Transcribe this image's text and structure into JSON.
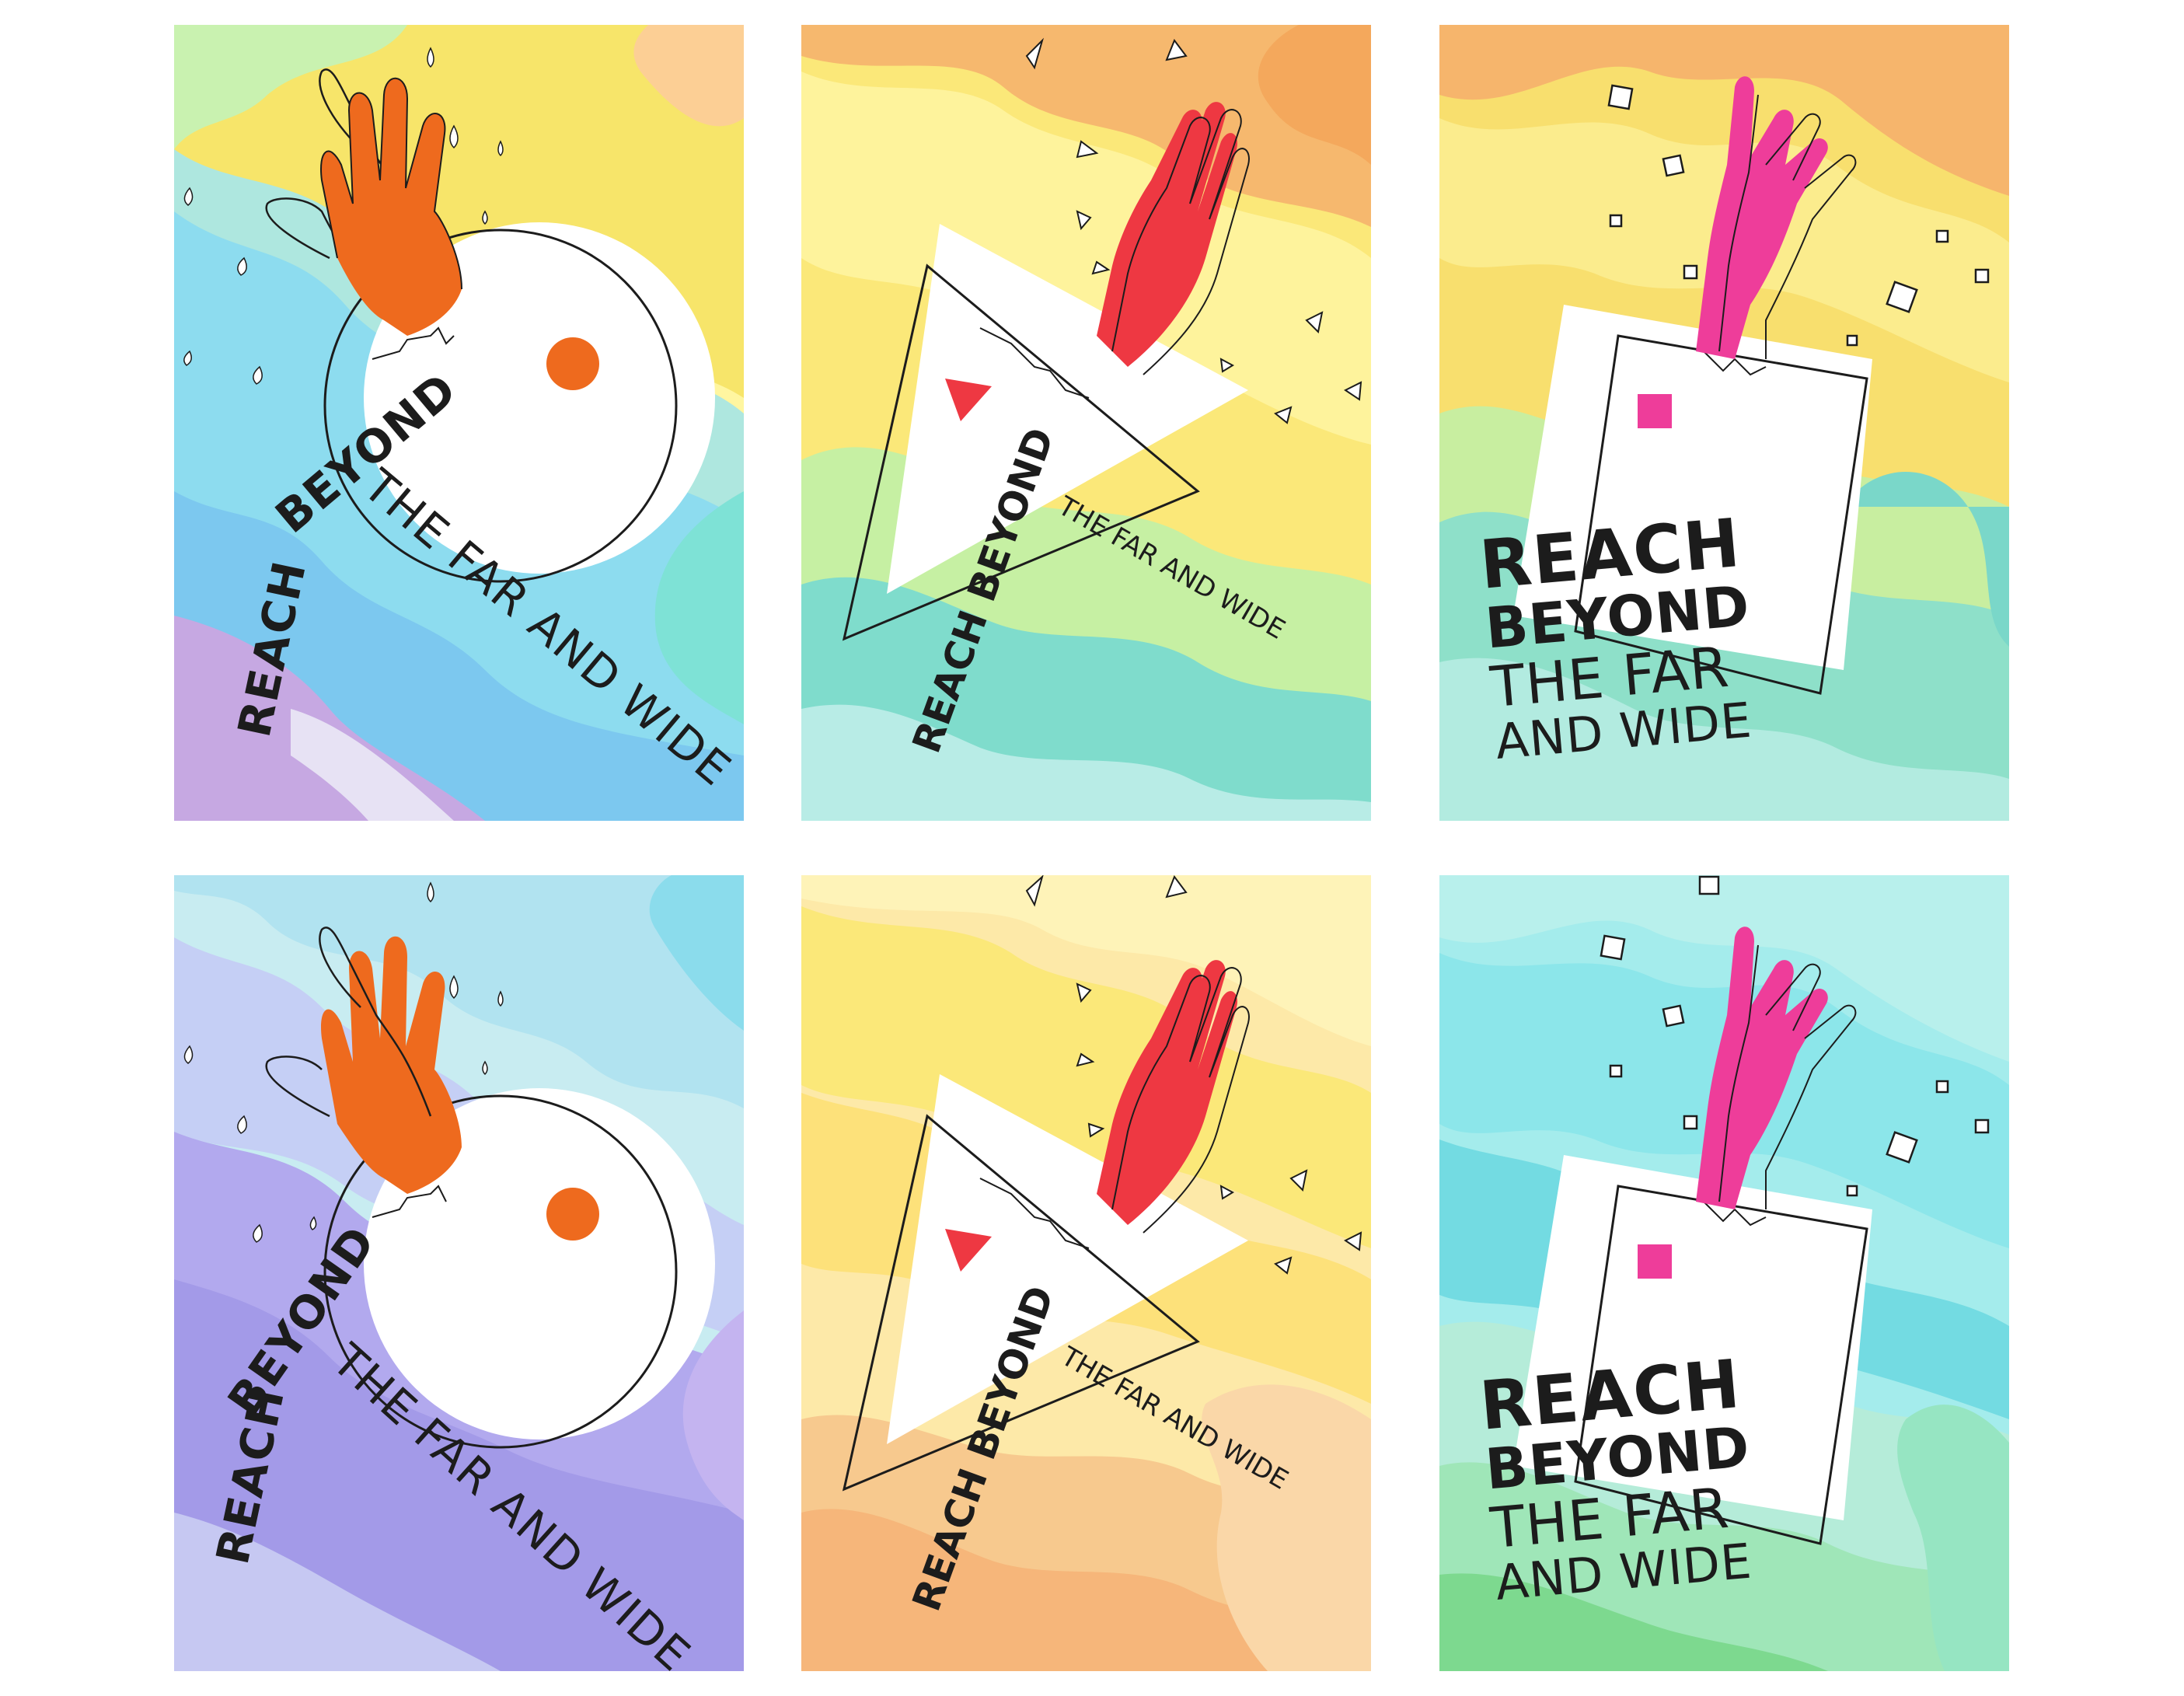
{
  "posters": [
    {
      "layout": "circle",
      "text": {
        "reach": "REACH",
        "beyond": "BEYOND",
        "rest": "THE FAR AND WIDE"
      },
      "colors": {
        "accent": "#ee6a1e",
        "bg1": "#b6e9e6",
        "bg2": "#82cfee",
        "bg3": "#f8e96c",
        "bg4": "#c4a2e0"
      }
    },
    {
      "layout": "triangle",
      "text": {
        "reach_beyond": "REACH BEYOND",
        "rest": "THE FAR AND WIDE"
      },
      "colors": {
        "accent": "#ee3842",
        "bg1": "#fbe879",
        "bg2": "#f6b86e",
        "bg3": "#7fdccc",
        "bg4": "#c6f0a3"
      }
    },
    {
      "layout": "square",
      "text": {
        "line1": "REACH",
        "line2": "BEYOND",
        "line3": "THE FAR",
        "line4": "AND WIDE"
      },
      "colors": {
        "accent": "#ee3d9a",
        "bg1": "#f8df6e",
        "bg2": "#f6b56c",
        "bg3": "#8ee0c9",
        "bg4": "#c8eea0"
      }
    },
    {
      "layout": "circle",
      "text": {
        "reach": "REACH",
        "beyond": "BEYOND",
        "rest": "THE FAR AND WIDE"
      },
      "colors": {
        "accent": "#ee6a1e",
        "bg1": "#c8ecf1",
        "bg2": "#8bdcec",
        "bg3": "#a9a2ec",
        "bg4": "#c4b4f0"
      }
    },
    {
      "layout": "triangle",
      "text": {
        "reach_beyond": "REACH BEYOND",
        "rest": "THE FAR AND WIDE"
      },
      "colors": {
        "accent": "#ee3842",
        "bg1": "#fbe879",
        "bg2": "#f6c27c",
        "bg3": "#fde9a8",
        "bg4": "#f7b67a"
      }
    },
    {
      "layout": "square",
      "text": {
        "line1": "REACH",
        "line2": "BEYOND",
        "line3": "THE FAR",
        "line4": "AND WIDE"
      },
      "colors": {
        "accent": "#ee3d9a",
        "bg1": "#a4ecec",
        "bg2": "#73dbe2",
        "bg3": "#b5ecd9",
        "bg4": "#7dd98f"
      }
    }
  ]
}
